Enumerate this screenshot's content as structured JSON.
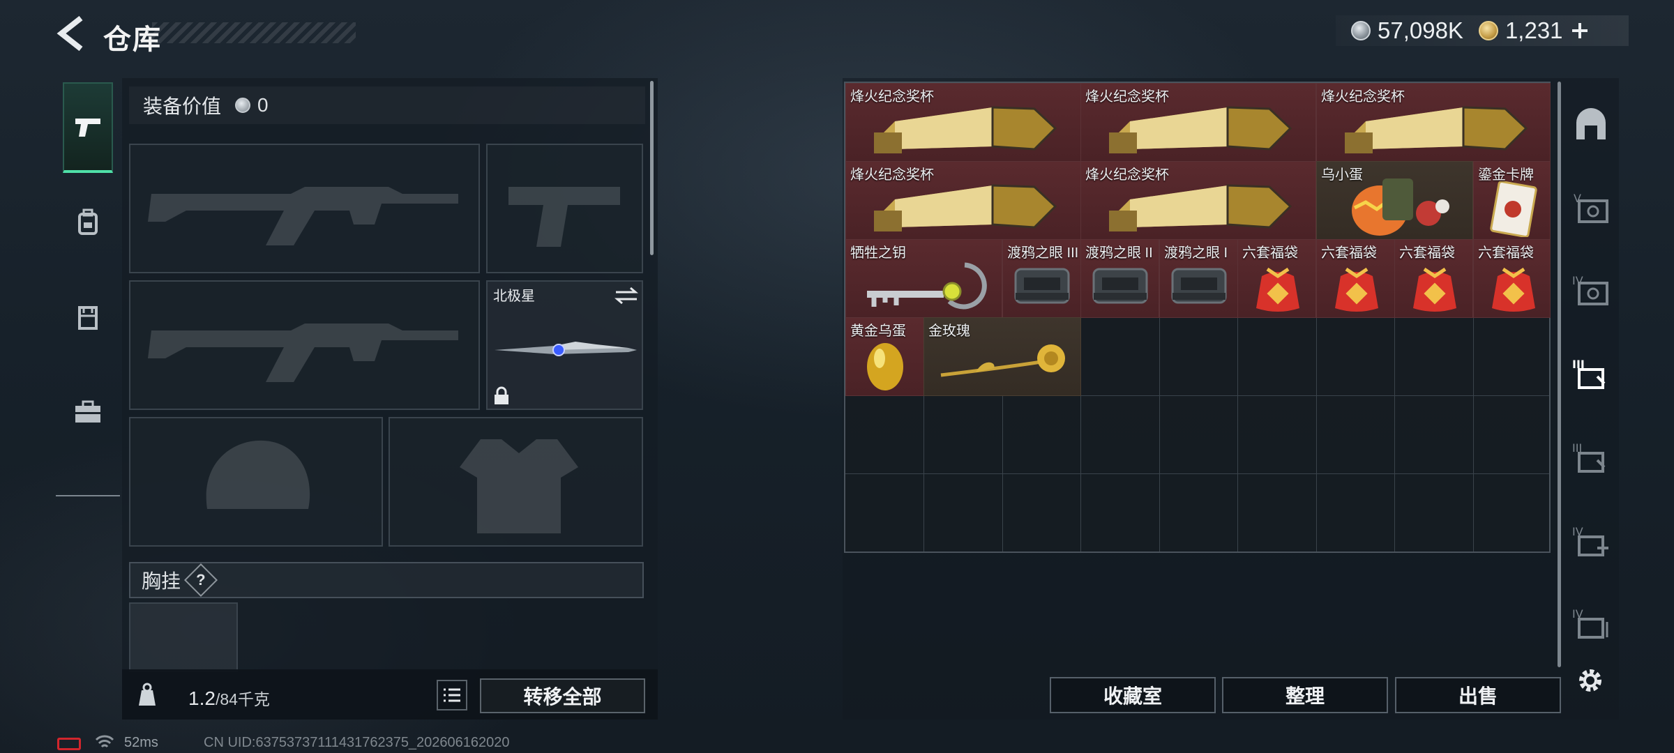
{
  "header": {
    "title": "仓库"
  },
  "currency": {
    "silver": "57,098K",
    "gold": "1,231"
  },
  "equipment": {
    "value_label": "装备价值",
    "value": "0",
    "melee_name": "北极星",
    "chest_label": "胸挂",
    "help": "?"
  },
  "footer": {
    "weight_current": "1.2",
    "weight_max": "/84千克",
    "transfer_all": "转移全部"
  },
  "status": {
    "ping": "52ms",
    "uid": "CN UID:637537371114317623​75_202606162020"
  },
  "items": [
    {
      "name": "烽火纪念奖杯"
    },
    {
      "name": "烽火纪念奖杯"
    },
    {
      "name": "烽火纪念奖杯"
    },
    {
      "name": "烽火纪念奖杯"
    },
    {
      "name": "烽火纪念奖杯"
    },
    {
      "name": "乌小蛋"
    },
    {
      "name": "鎏金卡牌"
    },
    {
      "name": "牺牲之钥"
    },
    {
      "name": "渡鸦之眼 III"
    },
    {
      "name": "渡鸦之眼 II"
    },
    {
      "name": "渡鸦之眼 I"
    },
    {
      "name": "六套福袋"
    },
    {
      "name": "六套福袋"
    },
    {
      "name": "六套福袋"
    },
    {
      "name": "六套福袋"
    },
    {
      "name": "黄金乌蛋"
    },
    {
      "name": "金玫瑰"
    }
  ],
  "actions": {
    "collection": "收藏室",
    "sort": "整理",
    "sell": "出售"
  },
  "icons": [
    "back-arrow-icon",
    "silver-coin-icon",
    "gold-coin-icon",
    "plus-icon",
    "pistol-icon",
    "backpack-icon",
    "vest-icon",
    "toolbox-icon",
    "lock-icon",
    "list-icon",
    "swap-icon",
    "gear-icon",
    "safe-icon"
  ],
  "colors": {
    "accent": "#4fe0a8",
    "item_red": "#5a2a2e",
    "battery_low": "#d2262d"
  }
}
